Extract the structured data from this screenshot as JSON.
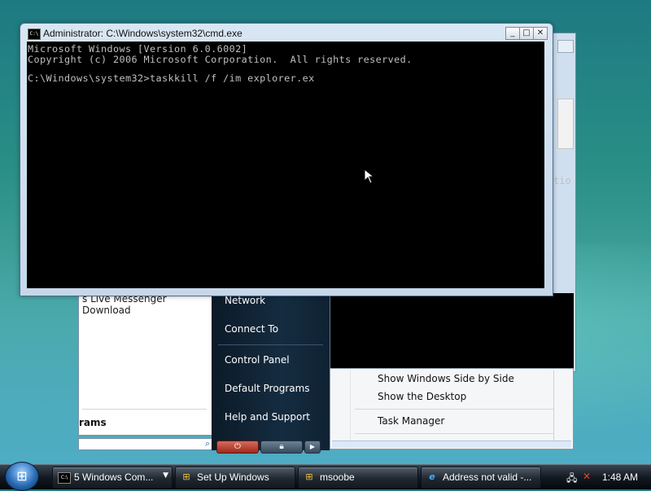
{
  "cmd_window": {
    "title": "Administrator: C:\\Windows\\system32\\cmd.exe",
    "icon": "C:\\",
    "lines": [
      "Microsoft Windows [Version 6.0.6002]",
      "Copyright (c) 2006 Microsoft Corporation.  All rights reserved.",
      "",
      "C:\\Windows\\system32>taskkill /f /im explorer.ex"
    ],
    "minimize_symbol": "_",
    "maximize_symbol": "□",
    "close_symbol": "✕"
  },
  "background_console": {
    "fragment": "tio"
  },
  "start_menu": {
    "recent_item": "s Live Messenger Download",
    "all_programs": "rams",
    "right_links": [
      "Network",
      "Connect To",
      "Control Panel",
      "Default Programs",
      "Help and Support"
    ]
  },
  "context_menu": {
    "items": [
      "Show Windows Side by Side",
      "Show the Desktop",
      "Task Manager"
    ]
  },
  "taskbar": {
    "start_symbol": "⊞",
    "buttons": [
      {
        "label": "5 Windows Com...",
        "icon": "C:\\"
      },
      {
        "label": "Set Up Windows",
        "icon": "⊞"
      },
      {
        "label": "msoobe",
        "icon": "⊞"
      },
      {
        "label": "Address not valid -...",
        "icon": "e"
      }
    ],
    "clock": "1:48 AM"
  }
}
